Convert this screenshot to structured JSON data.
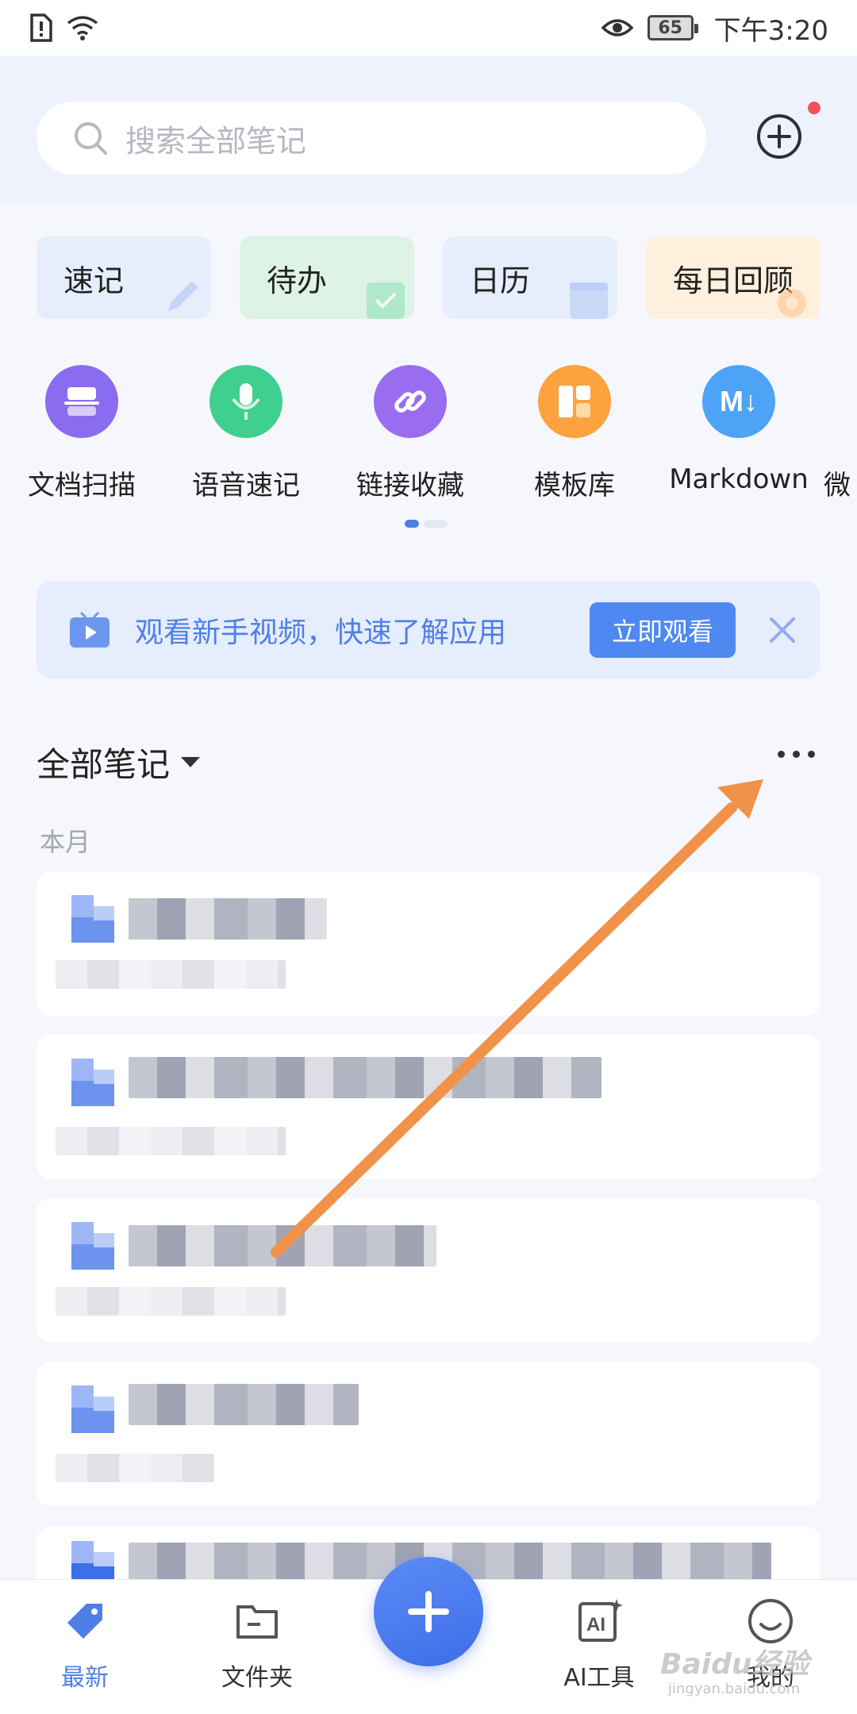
{
  "status_bar": {
    "time": "下午3:20",
    "battery": "65"
  },
  "search": {
    "placeholder": "搜索全部笔记"
  },
  "quick_cards": [
    {
      "label": "速记",
      "bg": "#e6eefc",
      "icon": "pencil-icon"
    },
    {
      "label": "待办",
      "bg": "#dcf3e6",
      "icon": "calendar-check-icon"
    },
    {
      "label": "日历",
      "bg": "#e6eefc",
      "icon": "calendar-13-icon"
    },
    {
      "label": "每日回顾",
      "bg": "#fff0de",
      "icon": "flower-icon"
    }
  ],
  "tools": [
    {
      "label": "文档扫描",
      "color": "#8a6cf0",
      "icon": "scan-icon"
    },
    {
      "label": "语音速记",
      "color": "#3fcf8e",
      "icon": "microphone-icon"
    },
    {
      "label": "链接收藏",
      "color": "#9a6cf0",
      "icon": "link-icon"
    },
    {
      "label": "模板库",
      "color": "#fca23e",
      "icon": "template-icon"
    },
    {
      "label": "Markdown",
      "color": "#4da4f6",
      "icon": "markdown-icon",
      "icon_text": "M↓"
    },
    {
      "label": "微",
      "color": "#3fcf8e",
      "icon": "more-tool-icon"
    }
  ],
  "banner": {
    "text": "观看新手视频，快速了解应用",
    "button": "立即观看"
  },
  "section": {
    "title": "全部笔记",
    "month": "本月"
  },
  "nav": {
    "items": [
      {
        "label": "最新",
        "active": true
      },
      {
        "label": "文件夹",
        "active": false
      },
      {
        "label": "AI工具",
        "active": false
      },
      {
        "label": "我的",
        "active": false
      }
    ]
  },
  "colors": {
    "accent": "#4f7fe6",
    "arrow": "#f0924a"
  },
  "watermark": {
    "text": "Baidu经验",
    "sub": "jingyan.baidu.com"
  }
}
